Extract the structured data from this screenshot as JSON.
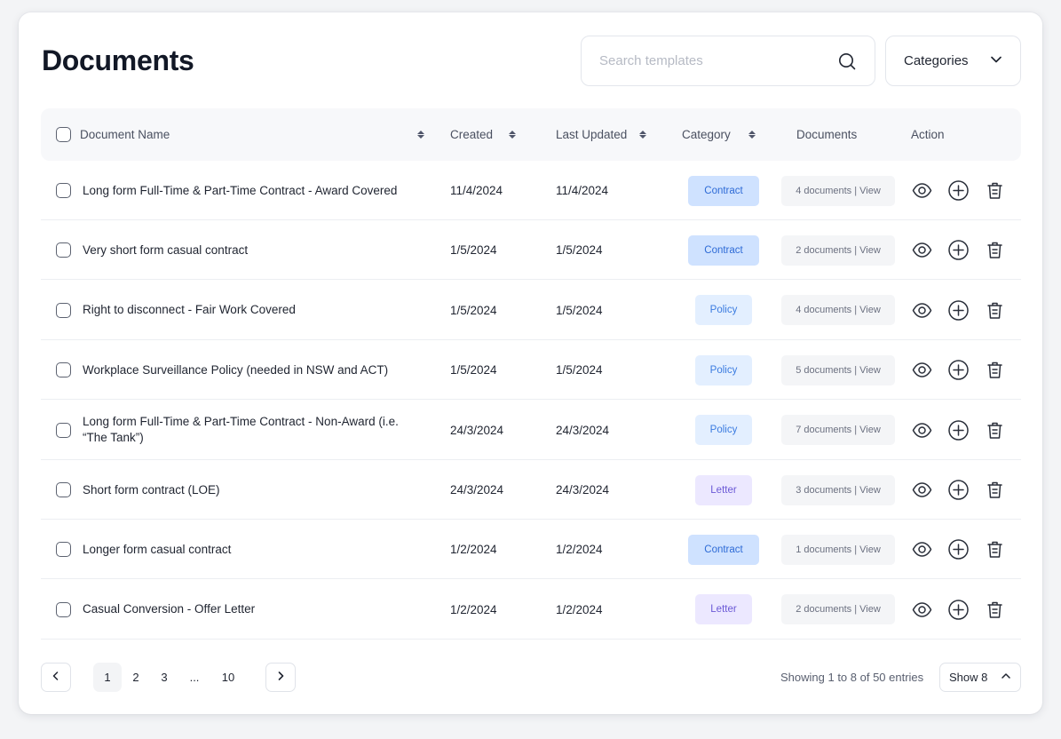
{
  "header": {
    "title": "Documents",
    "search_placeholder": "Search templates",
    "categories_label": "Categories"
  },
  "table": {
    "columns": {
      "name": "Document Name",
      "created": "Created",
      "updated": "Last Updated",
      "category": "Category",
      "documents": "Documents",
      "action": "Action"
    },
    "rows": [
      {
        "name": "Long form Full-Time & Part-Time Contract - Award Covered",
        "created": "11/4/2024",
        "updated": "11/4/2024",
        "category": "Contract",
        "docs": "4 documents | View"
      },
      {
        "name": "Very short form casual contract",
        "created": "1/5/2024",
        "updated": "1/5/2024",
        "category": "Contract",
        "docs": "2 documents | View"
      },
      {
        "name": "Right to disconnect - Fair Work Covered",
        "created": "1/5/2024",
        "updated": "1/5/2024",
        "category": "Policy",
        "docs": "4 documents | View"
      },
      {
        "name": "Workplace Surveillance Policy (needed in NSW and ACT)",
        "created": "1/5/2024",
        "updated": "1/5/2024",
        "category": "Policy",
        "docs": "5 documents | View"
      },
      {
        "name": "Long form Full-Time  & Part-Time Contract - Non-Award (i.e. “The Tank”)",
        "created": "24/3/2024",
        "updated": "24/3/2024",
        "category": "Policy",
        "docs": "7 documents | View"
      },
      {
        "name": "Short form contract (LOE)",
        "created": "24/3/2024",
        "updated": "24/3/2024",
        "category": "Letter",
        "docs": "3 documents | View"
      },
      {
        "name": "Longer form casual contract",
        "created": "1/2/2024",
        "updated": "1/2/2024",
        "category": "Contract",
        "docs": "1 documents | View"
      },
      {
        "name": "Casual Conversion -  Offer Letter",
        "created": "1/2/2024",
        "updated": "1/2/2024",
        "category": "Letter",
        "docs": "2 documents | View"
      }
    ]
  },
  "pagination": {
    "pages": [
      "1",
      "2",
      "3",
      "...",
      "10"
    ],
    "active_page": "1",
    "showing": "Showing 1 to 8 of 50 entries",
    "page_size_label": "Show 8"
  },
  "colors": {
    "contract_bg": "#cfe2ff",
    "policy_bg": "#e3efff",
    "letter_bg": "#ece8ff"
  },
  "icons": {
    "search": "search-icon",
    "dropdown": "chevron-down-icon",
    "view": "eye-icon",
    "add": "plus-circle-icon",
    "delete": "trash-icon",
    "prev": "chevron-left-icon",
    "next": "chevron-right-icon",
    "size_toggle": "chevron-up-icon"
  }
}
